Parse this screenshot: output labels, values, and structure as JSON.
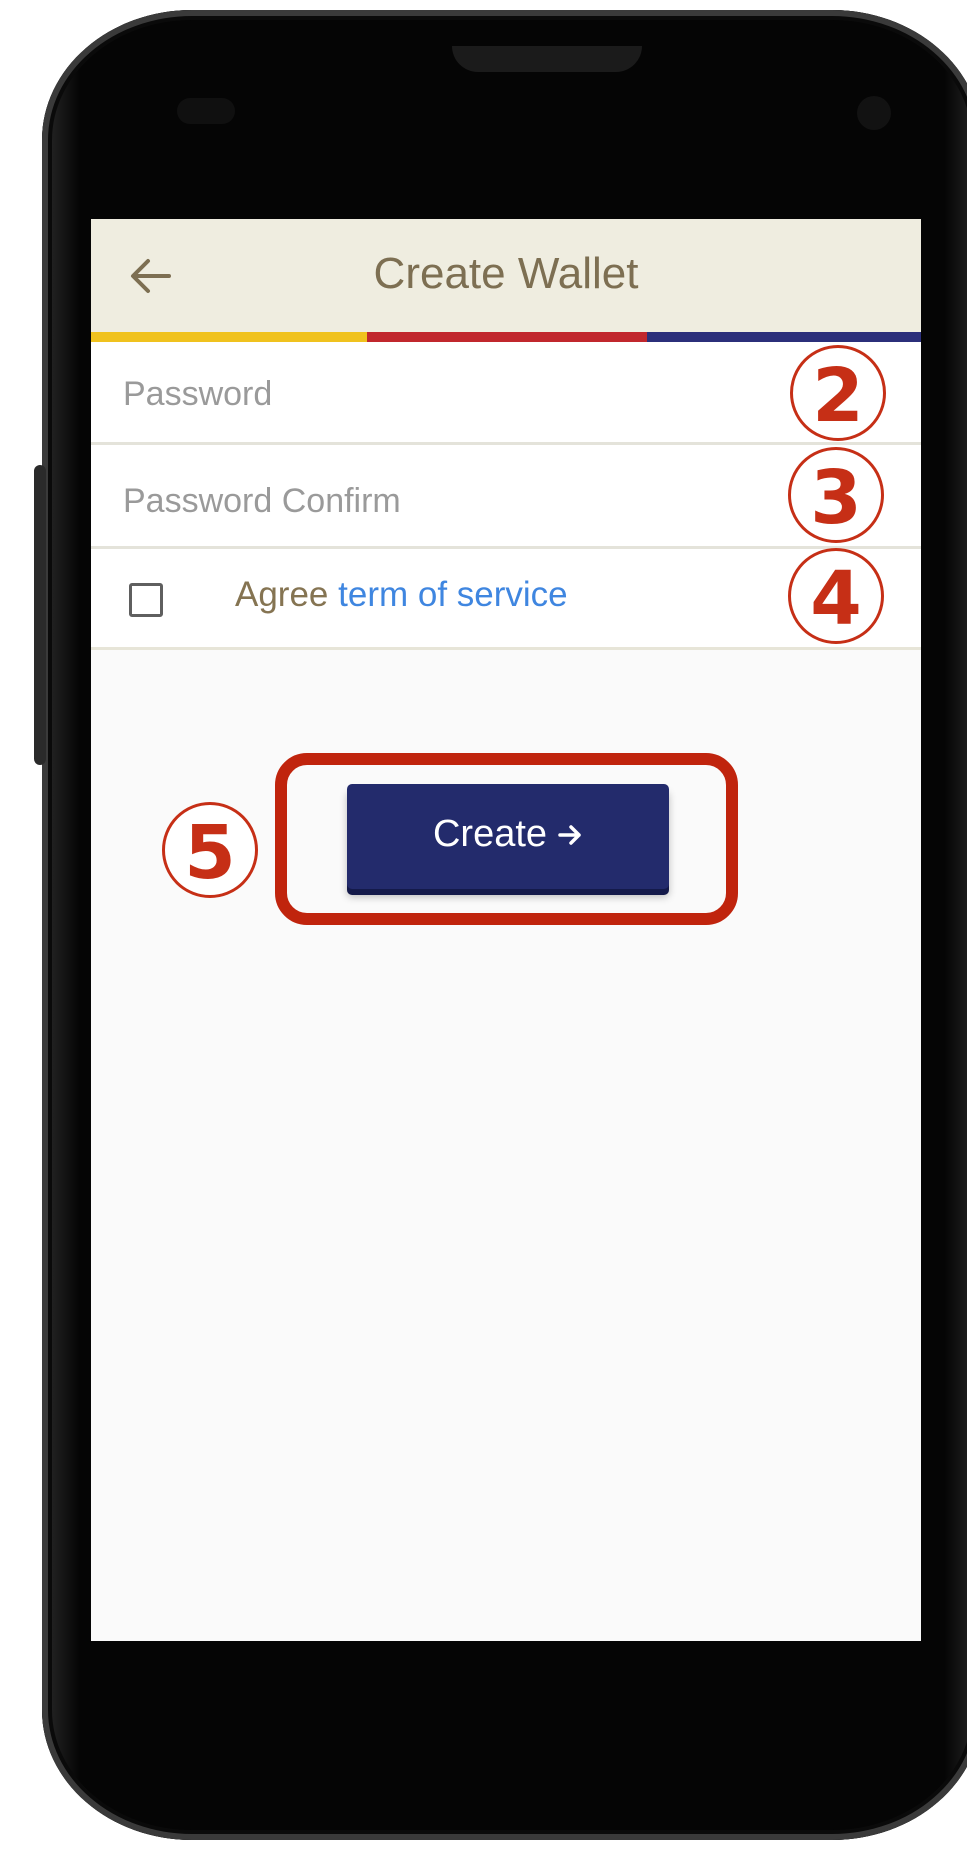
{
  "appbar": {
    "title": "Create Wallet",
    "back_icon": "arrow-left-icon"
  },
  "stripe_colors": [
    "#f0c21e",
    "#c1272d",
    "#2b2f7a"
  ],
  "form": {
    "password_placeholder": "Password",
    "password_confirm_placeholder": "Password Confirm",
    "agree_prefix": "Agree",
    "terms_link": "term of service",
    "checkbox_checked": false
  },
  "create_button": {
    "label": "Create",
    "icon": "arrow-right-icon"
  },
  "annotations": {
    "badge_2": "2",
    "badge_3": "3",
    "badge_4": "4",
    "badge_5": "5"
  },
  "colors": {
    "appbar_bg": "#efede0",
    "title_color": "#7d6f52",
    "button_bg": "#232b6c",
    "link_color": "#3f86e0",
    "annotation_red": "#c62f16"
  }
}
